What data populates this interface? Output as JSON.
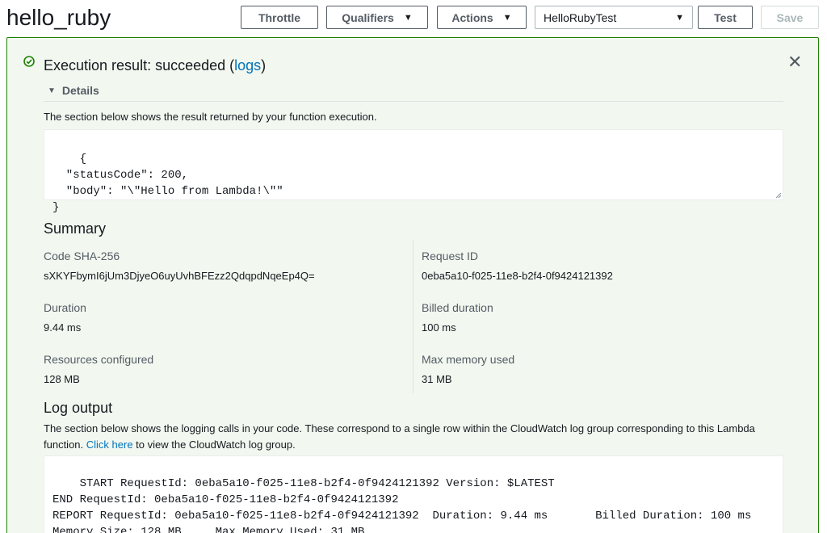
{
  "header": {
    "title": "hello_ruby",
    "throttle_label": "Throttle",
    "qualifiers_label": "Qualifiers",
    "actions_label": "Actions",
    "test_event_selected": "HelloRubyTest",
    "test_label": "Test",
    "save_label": "Save"
  },
  "result": {
    "title_prefix": "Execution result: succeeded (",
    "logs_link": "logs",
    "title_suffix": ")",
    "details_label": "Details",
    "description": "The section below shows the result returned by your function execution.",
    "output": "{\n  \"statusCode\": 200,\n  \"body\": \"\\\"Hello from Lambda!\\\"\"\n}"
  },
  "summary": {
    "heading": "Summary",
    "code_sha_label": "Code SHA-256",
    "code_sha_value": "sXKYFbymI6jUm3DjyeO6uyUvhBFEzz2QdqpdNqeEp4Q=",
    "request_id_label": "Request ID",
    "request_id_value": "0eba5a10-f025-11e8-b2f4-0f9424121392",
    "duration_label": "Duration",
    "duration_value": "9.44 ms",
    "billed_label": "Billed duration",
    "billed_value": "100 ms",
    "resources_label": "Resources configured",
    "resources_value": "128 MB",
    "max_memory_label": "Max memory used",
    "max_memory_value": "31 MB"
  },
  "log": {
    "heading": "Log output",
    "description_1": "The section below shows the logging calls in your code. These correspond to a single row within the CloudWatch log group corresponding to this Lambda function. ",
    "click_here": "Click here",
    "description_2": " to view the CloudWatch log group.",
    "output": "START RequestId: 0eba5a10-f025-11e8-b2f4-0f9424121392 Version: $LATEST\nEND RequestId: 0eba5a10-f025-11e8-b2f4-0f9424121392\nREPORT RequestId: 0eba5a10-f025-11e8-b2f4-0f9424121392  Duration: 9.44 ms       Billed Duration: 100 ms\nMemory Size: 128 MB     Max Memory Used: 31 MB"
  },
  "colors": {
    "success": "#1d8102",
    "link": "#0073bb",
    "panel_bg": "#f2f8f0"
  }
}
